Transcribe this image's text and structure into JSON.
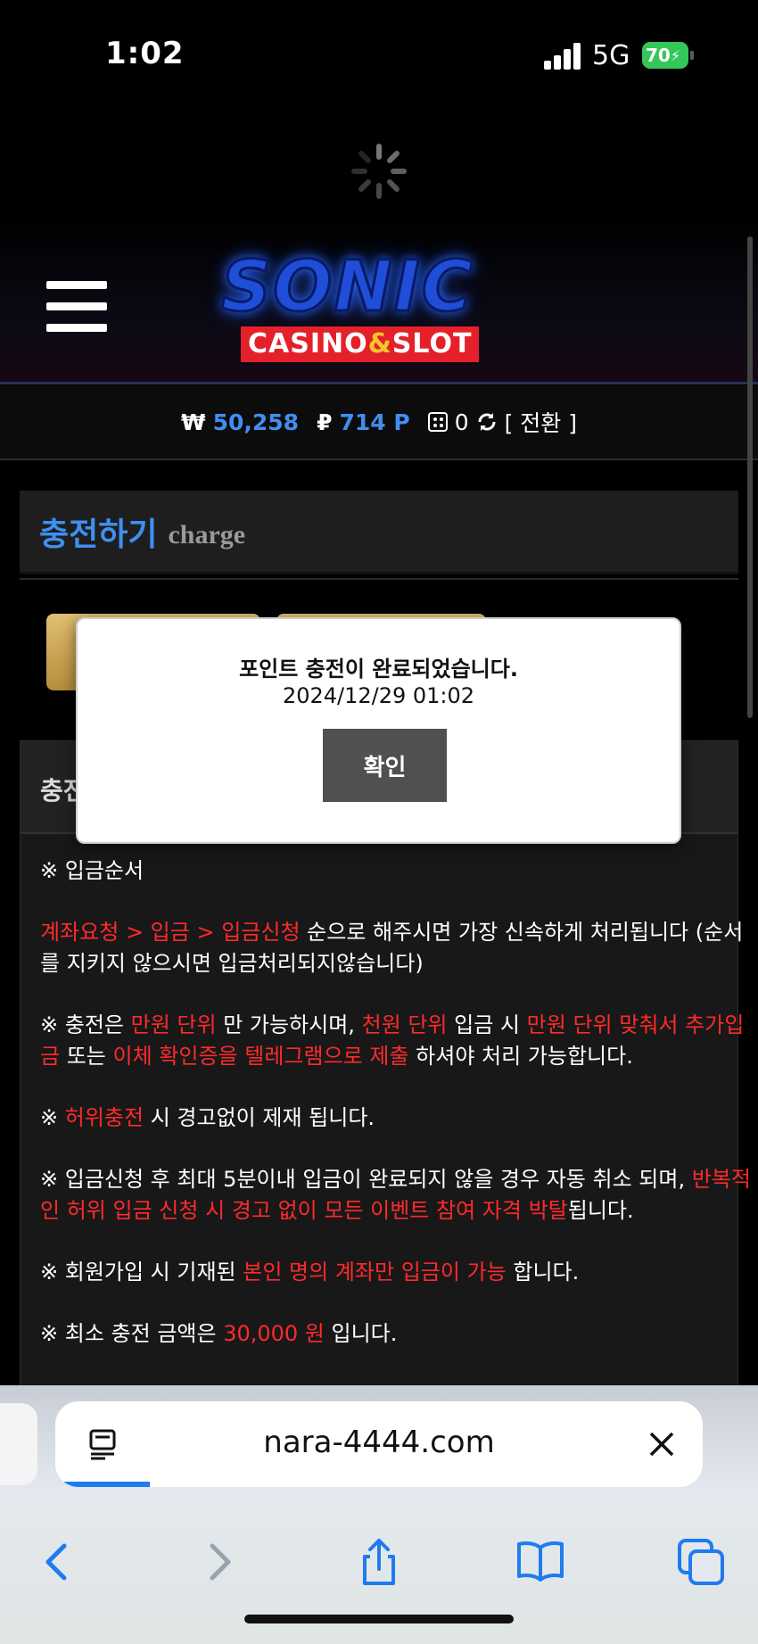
{
  "status_bar": {
    "time": "1:02",
    "network": "5G",
    "battery": "70"
  },
  "header": {
    "logo_main": "SONIC",
    "logo_sub_1": "CASINO",
    "logo_sub_amp": "&",
    "logo_sub_2": "SLOT"
  },
  "balance": {
    "won_symbol": "₩",
    "won_value": "50,258",
    "point_symbol": "₽",
    "point_value": "714 P",
    "dice_value": "0",
    "switch_label": "[ 전환 ]"
  },
  "charge": {
    "title_ko": "충전하기",
    "title_en": "charge",
    "panel_label": "충전"
  },
  "info": {
    "p1": "※ 입금순서",
    "p2_red": "계좌요청 > 입금 > 입금신청",
    "p2_rest": " 순으로 해주시면 가장 신속하게 처리됩니다 (순서를 지키지 않으시면 입금처리되지않습니다)",
    "p3_a": "※ 충전은 ",
    "p3_b": "만원 단위",
    "p3_c": " 만 가능하시며, ",
    "p3_d": "천원 단위",
    "p3_e": " 입금 시 ",
    "p3_f": "만원 단위 맞춰서 추가입금",
    "p3_g": " 또는 ",
    "p3_h": "이체 확인증을 텔레그램으로 제출",
    "p3_i": " 하셔야 처리 가능합니다.",
    "p4_a": "※ ",
    "p4_b": "허위충전",
    "p4_c": " 시 경고없이 제재 됩니다.",
    "p5_a": "※ 입금신청 후 최대 5분이내 입금이 완료되지 않을 경우 자동 취소 되며, ",
    "p5_b": "반복적인 허위 입금 신청 시 경고 없이 모든 이벤트 참여 자격 박탈",
    "p5_c": "됩니다.",
    "p6_a": "※ 회원가입 시 기재된 ",
    "p6_b": "본인 명의 계좌만 입금이 가능",
    "p6_c": " 합니다.",
    "p7_a": "※ 최소 충전 금액은 ",
    "p7_b": "30,000 원",
    "p7_c": " 입니다."
  },
  "modal": {
    "message": "포인트 충전이 완료되었습니다.",
    "timestamp": "2024/12/29 01:02",
    "confirm_label": "확인"
  },
  "browser": {
    "url": "nara-4444.com"
  },
  "colors": {
    "accent_blue": "#3f8ff0",
    "warning_red": "#ff2a2a",
    "gold": "#d4ae5e",
    "ios_blue": "#1e7bf0"
  }
}
